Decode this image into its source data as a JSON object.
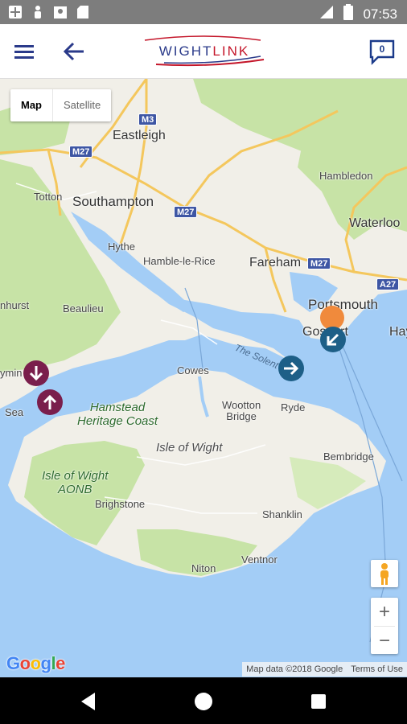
{
  "status_bar": {
    "time": "07:53",
    "network": "LTE"
  },
  "header": {
    "logo_left": "WIGHT",
    "logo_right": "LINK",
    "chat_count": "0"
  },
  "map": {
    "type_control": {
      "map": "Map",
      "satellite": "Satellite",
      "selected": "Map"
    },
    "places": {
      "eastleigh": "Eastleigh",
      "hambledon": "Hambledon",
      "totton": "Totton",
      "southampton": "Southampton",
      "waterloo": "Waterloo",
      "hythe": "Hythe",
      "hamble": "Hamble-le-Rice",
      "fareham": "Fareham",
      "portsmouth": "Portsmouth",
      "hurst": "nhurst",
      "beaulieu": "Beaulieu",
      "gosport": "Gosport",
      "hay": "Hay",
      "lymington": "ymin",
      "sea": "Sea",
      "cowes": "Cowes",
      "wootton": "Wootton\nBridge",
      "ryde": "Ryde",
      "iow": "Isle of Wight",
      "bembridge": "Bembridge",
      "brighstone": "Brighstone",
      "shanklin": "Shanklin",
      "ventnor": "Ventnor",
      "niton": "Niton",
      "hamstead": "Hamstead\nHeritage Coast",
      "iow_aonb": "Isle of Wight\nAONB",
      "solent": "The Solent"
    },
    "roads": {
      "m3": "M3",
      "m27_a": "M27",
      "m27_b": "M27",
      "m27_c": "M27",
      "a27": "A27"
    },
    "attribution": {
      "data": "Map data ©2018 Google",
      "terms": "Terms of Use"
    },
    "zoom": {
      "in": "+",
      "out": "−"
    },
    "google": [
      "G",
      "o",
      "o",
      "g",
      "l",
      "e"
    ],
    "colors": {
      "water": "#a3cdf6",
      "land": "#f1efe8",
      "park": "#c7e3a6",
      "road": "#f4c75d",
      "marker_maroon": "#7a1e4c",
      "marker_teal": "#1d5f87",
      "marker_orange": "#f08a3c",
      "brand_blue": "#2a3a8a",
      "brand_red": "#c4162a"
    }
  }
}
